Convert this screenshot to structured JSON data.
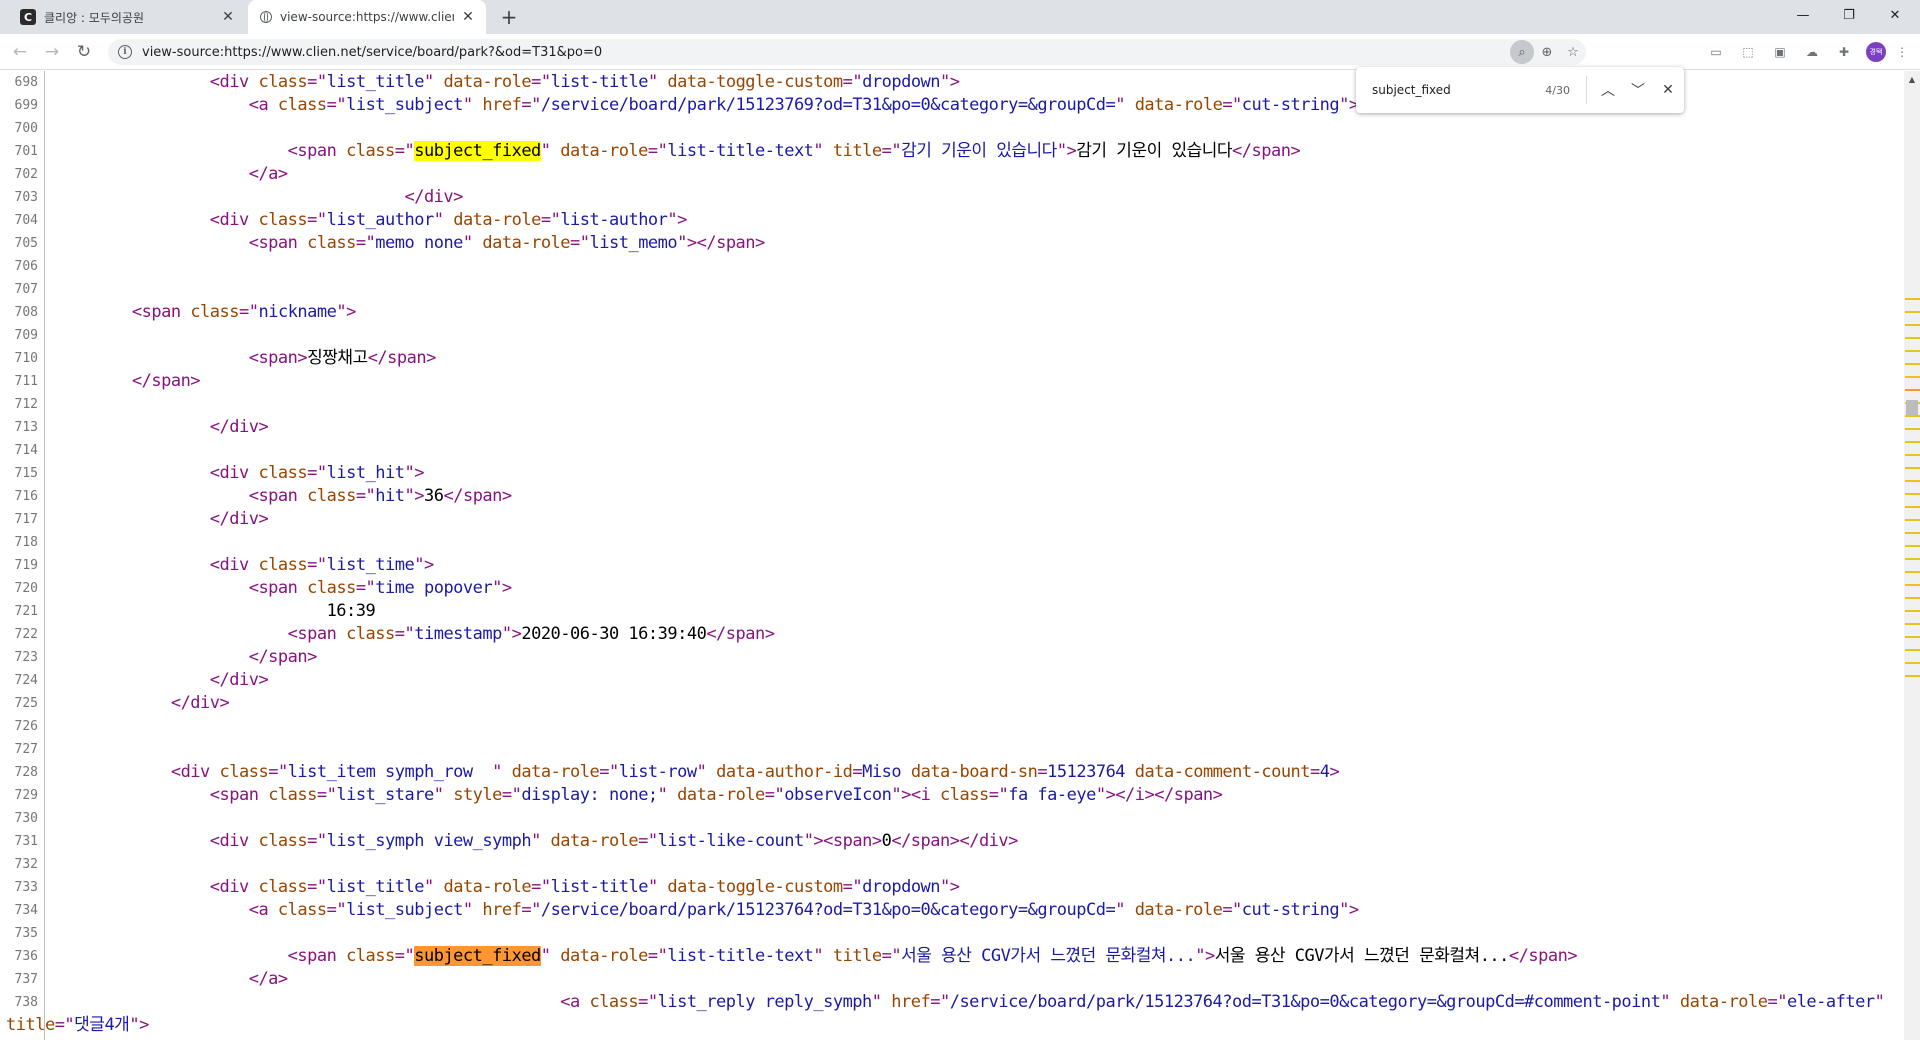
{
  "tabs": [
    {
      "title": "클리앙 : 모두의공원",
      "favicon": "C"
    },
    {
      "title": "view-source:https://www.clien.ne"
    }
  ],
  "new_tab_symbol": "+",
  "window_controls": {
    "minimize": "—",
    "maximize": "❐",
    "close": "✕"
  },
  "url": "view-source:https://www.clien.net/service/board/park?&od=T31&po=0",
  "avatar_text": "경택",
  "find": {
    "query": "subject_fixed",
    "count": "4/30"
  },
  "lines": [
    {
      "n": "698",
      "s": [
        {
          "c": "x",
          "t": "                "
        },
        {
          "c": "t",
          "t": "<div "
        },
        {
          "c": "a",
          "t": "class"
        },
        {
          "c": "t",
          "t": "=\""
        },
        {
          "c": "v",
          "t": "list_title"
        },
        {
          "c": "t",
          "t": "\" "
        },
        {
          "c": "a",
          "t": "data-role"
        },
        {
          "c": "t",
          "t": "=\""
        },
        {
          "c": "v",
          "t": "list-title"
        },
        {
          "c": "t",
          "t": "\" "
        },
        {
          "c": "a",
          "t": "data-toggle-custom"
        },
        {
          "c": "t",
          "t": "=\""
        },
        {
          "c": "v",
          "t": "dropdown"
        },
        {
          "c": "t",
          "t": "\">"
        }
      ]
    },
    {
      "n": "699",
      "s": [
        {
          "c": "x",
          "t": "                    "
        },
        {
          "c": "t",
          "t": "<a "
        },
        {
          "c": "a",
          "t": "class"
        },
        {
          "c": "t",
          "t": "=\""
        },
        {
          "c": "v",
          "t": "list_subject"
        },
        {
          "c": "t",
          "t": "\" "
        },
        {
          "c": "a",
          "t": "href"
        },
        {
          "c": "t",
          "t": "=\""
        },
        {
          "c": "v",
          "t": "/service/board/park/15123769?od=T31&po=0&category=&groupCd="
        },
        {
          "c": "t",
          "t": "\" "
        },
        {
          "c": "a",
          "t": "data-role"
        },
        {
          "c": "t",
          "t": "=\""
        },
        {
          "c": "v",
          "t": "cut-string"
        },
        {
          "c": "t",
          "t": "\">"
        }
      ]
    },
    {
      "n": "700",
      "s": []
    },
    {
      "n": "701",
      "s": [
        {
          "c": "x",
          "t": "                        "
        },
        {
          "c": "t",
          "t": "<span "
        },
        {
          "c": "a",
          "t": "class"
        },
        {
          "c": "t",
          "t": "=\""
        },
        {
          "c": "hl",
          "t": "subject_fixed"
        },
        {
          "c": "t",
          "t": "\" "
        },
        {
          "c": "a",
          "t": "data-role"
        },
        {
          "c": "t",
          "t": "=\""
        },
        {
          "c": "v",
          "t": "list-title-text"
        },
        {
          "c": "t",
          "t": "\" "
        },
        {
          "c": "a",
          "t": "title"
        },
        {
          "c": "t",
          "t": "=\""
        },
        {
          "c": "v",
          "t": "감기 기운이 있습니다"
        },
        {
          "c": "t",
          "t": "\">"
        },
        {
          "c": "x",
          "t": "감기 기운이 있습니다"
        },
        {
          "c": "t",
          "t": "</span>"
        }
      ]
    },
    {
      "n": "702",
      "s": [
        {
          "c": "x",
          "t": "                    "
        },
        {
          "c": "t",
          "t": "</a>"
        }
      ]
    },
    {
      "n": "703",
      "s": [
        {
          "c": "x",
          "t": "                                    "
        },
        {
          "c": "t",
          "t": "</div>"
        }
      ]
    },
    {
      "n": "704",
      "s": [
        {
          "c": "x",
          "t": "                "
        },
        {
          "c": "t",
          "t": "<div "
        },
        {
          "c": "a",
          "t": "class"
        },
        {
          "c": "t",
          "t": "=\""
        },
        {
          "c": "v",
          "t": "list_author"
        },
        {
          "c": "t",
          "t": "\" "
        },
        {
          "c": "a",
          "t": "data-role"
        },
        {
          "c": "t",
          "t": "=\""
        },
        {
          "c": "v",
          "t": "list-author"
        },
        {
          "c": "t",
          "t": "\">"
        }
      ]
    },
    {
      "n": "705",
      "s": [
        {
          "c": "x",
          "t": "                    "
        },
        {
          "c": "t",
          "t": "<span "
        },
        {
          "c": "a",
          "t": "class"
        },
        {
          "c": "t",
          "t": "=\""
        },
        {
          "c": "v",
          "t": "memo none"
        },
        {
          "c": "t",
          "t": "\" "
        },
        {
          "c": "a",
          "t": "data-role"
        },
        {
          "c": "t",
          "t": "=\""
        },
        {
          "c": "v",
          "t": "list_memo"
        },
        {
          "c": "t",
          "t": "\"></span>"
        }
      ]
    },
    {
      "n": "706",
      "s": []
    },
    {
      "n": "707",
      "s": []
    },
    {
      "n": "708",
      "s": [
        {
          "c": "x",
          "t": "        "
        },
        {
          "c": "t",
          "t": "<span "
        },
        {
          "c": "a",
          "t": "class"
        },
        {
          "c": "t",
          "t": "=\""
        },
        {
          "c": "v",
          "t": "nickname"
        },
        {
          "c": "t",
          "t": "\">"
        }
      ]
    },
    {
      "n": "709",
      "s": []
    },
    {
      "n": "710",
      "s": [
        {
          "c": "x",
          "t": "                    "
        },
        {
          "c": "t",
          "t": "<span>"
        },
        {
          "c": "x",
          "t": "징짱채고"
        },
        {
          "c": "t",
          "t": "</span>"
        }
      ]
    },
    {
      "n": "711",
      "s": [
        {
          "c": "x",
          "t": "        "
        },
        {
          "c": "t",
          "t": "</span>"
        }
      ]
    },
    {
      "n": "712",
      "s": []
    },
    {
      "n": "713",
      "s": [
        {
          "c": "x",
          "t": "                "
        },
        {
          "c": "t",
          "t": "</div>"
        }
      ]
    },
    {
      "n": "714",
      "s": []
    },
    {
      "n": "715",
      "s": [
        {
          "c": "x",
          "t": "                "
        },
        {
          "c": "t",
          "t": "<div "
        },
        {
          "c": "a",
          "t": "class"
        },
        {
          "c": "t",
          "t": "=\""
        },
        {
          "c": "v",
          "t": "list_hit"
        },
        {
          "c": "t",
          "t": "\">"
        }
      ]
    },
    {
      "n": "716",
      "s": [
        {
          "c": "x",
          "t": "                    "
        },
        {
          "c": "t",
          "t": "<span "
        },
        {
          "c": "a",
          "t": "class"
        },
        {
          "c": "t",
          "t": "=\""
        },
        {
          "c": "v",
          "t": "hit"
        },
        {
          "c": "t",
          "t": "\">"
        },
        {
          "c": "x",
          "t": "36"
        },
        {
          "c": "t",
          "t": "</span>"
        }
      ]
    },
    {
      "n": "717",
      "s": [
        {
          "c": "x",
          "t": "                "
        },
        {
          "c": "t",
          "t": "</div>"
        }
      ]
    },
    {
      "n": "718",
      "s": []
    },
    {
      "n": "719",
      "s": [
        {
          "c": "x",
          "t": "                "
        },
        {
          "c": "t",
          "t": "<div "
        },
        {
          "c": "a",
          "t": "class"
        },
        {
          "c": "t",
          "t": "=\""
        },
        {
          "c": "v",
          "t": "list_time"
        },
        {
          "c": "t",
          "t": "\">"
        }
      ]
    },
    {
      "n": "720",
      "s": [
        {
          "c": "x",
          "t": "                    "
        },
        {
          "c": "t",
          "t": "<span "
        },
        {
          "c": "a",
          "t": "class"
        },
        {
          "c": "t",
          "t": "=\""
        },
        {
          "c": "v",
          "t": "time popover"
        },
        {
          "c": "t",
          "t": "\">"
        }
      ]
    },
    {
      "n": "721",
      "s": [
        {
          "c": "x",
          "t": "                            16:39"
        }
      ]
    },
    {
      "n": "722",
      "s": [
        {
          "c": "x",
          "t": "                        "
        },
        {
          "c": "t",
          "t": "<span "
        },
        {
          "c": "a",
          "t": "class"
        },
        {
          "c": "t",
          "t": "=\""
        },
        {
          "c": "v",
          "t": "timestamp"
        },
        {
          "c": "t",
          "t": "\">"
        },
        {
          "c": "x",
          "t": "2020-06-30 16:39:40"
        },
        {
          "c": "t",
          "t": "</span>"
        }
      ]
    },
    {
      "n": "723",
      "s": [
        {
          "c": "x",
          "t": "                    "
        },
        {
          "c": "t",
          "t": "</span>"
        }
      ]
    },
    {
      "n": "724",
      "s": [
        {
          "c": "x",
          "t": "                "
        },
        {
          "c": "t",
          "t": "</div>"
        }
      ]
    },
    {
      "n": "725",
      "s": [
        {
          "c": "x",
          "t": "            "
        },
        {
          "c": "t",
          "t": "</div>"
        }
      ]
    },
    {
      "n": "726",
      "s": []
    },
    {
      "n": "727",
      "s": []
    },
    {
      "n": "728",
      "s": [
        {
          "c": "x",
          "t": "            "
        },
        {
          "c": "t",
          "t": "<div "
        },
        {
          "c": "a",
          "t": "class"
        },
        {
          "c": "t",
          "t": "=\""
        },
        {
          "c": "v",
          "t": "list_item symph_row  "
        },
        {
          "c": "t",
          "t": "\" "
        },
        {
          "c": "a",
          "t": "data-role"
        },
        {
          "c": "t",
          "t": "=\""
        },
        {
          "c": "v",
          "t": "list-row"
        },
        {
          "c": "t",
          "t": "\" "
        },
        {
          "c": "a",
          "t": "data-author-id"
        },
        {
          "c": "t",
          "t": "="
        },
        {
          "c": "v",
          "t": "Miso"
        },
        {
          "c": "t",
          "t": " "
        },
        {
          "c": "a",
          "t": "data-board-sn"
        },
        {
          "c": "t",
          "t": "="
        },
        {
          "c": "v",
          "t": "15123764"
        },
        {
          "c": "t",
          "t": " "
        },
        {
          "c": "a",
          "t": "data-comment-count"
        },
        {
          "c": "t",
          "t": "="
        },
        {
          "c": "v",
          "t": "4"
        },
        {
          "c": "t",
          "t": ">"
        }
      ]
    },
    {
      "n": "729",
      "s": [
        {
          "c": "x",
          "t": "                "
        },
        {
          "c": "t",
          "t": "<span "
        },
        {
          "c": "a",
          "t": "class"
        },
        {
          "c": "t",
          "t": "=\""
        },
        {
          "c": "v",
          "t": "list_stare"
        },
        {
          "c": "t",
          "t": "\" "
        },
        {
          "c": "a",
          "t": "style"
        },
        {
          "c": "t",
          "t": "=\""
        },
        {
          "c": "v",
          "t": "display: none;"
        },
        {
          "c": "t",
          "t": "\" "
        },
        {
          "c": "a",
          "t": "data-role"
        },
        {
          "c": "t",
          "t": "=\""
        },
        {
          "c": "v",
          "t": "observeIcon"
        },
        {
          "c": "t",
          "t": "\"><i "
        },
        {
          "c": "a",
          "t": "class"
        },
        {
          "c": "t",
          "t": "=\""
        },
        {
          "c": "v",
          "t": "fa fa-eye"
        },
        {
          "c": "t",
          "t": "\"></i></span>"
        }
      ]
    },
    {
      "n": "730",
      "s": []
    },
    {
      "n": "731",
      "s": [
        {
          "c": "x",
          "t": "                "
        },
        {
          "c": "t",
          "t": "<div "
        },
        {
          "c": "a",
          "t": "class"
        },
        {
          "c": "t",
          "t": "=\""
        },
        {
          "c": "v",
          "t": "list_symph view_symph"
        },
        {
          "c": "t",
          "t": "\" "
        },
        {
          "c": "a",
          "t": "data-role"
        },
        {
          "c": "t",
          "t": "=\""
        },
        {
          "c": "v",
          "t": "list-like-count"
        },
        {
          "c": "t",
          "t": "\"><span>"
        },
        {
          "c": "x",
          "t": "0"
        },
        {
          "c": "t",
          "t": "</span></div>"
        }
      ]
    },
    {
      "n": "732",
      "s": []
    },
    {
      "n": "733",
      "s": [
        {
          "c": "x",
          "t": "                "
        },
        {
          "c": "t",
          "t": "<div "
        },
        {
          "c": "a",
          "t": "class"
        },
        {
          "c": "t",
          "t": "=\""
        },
        {
          "c": "v",
          "t": "list_title"
        },
        {
          "c": "t",
          "t": "\" "
        },
        {
          "c": "a",
          "t": "data-role"
        },
        {
          "c": "t",
          "t": "=\""
        },
        {
          "c": "v",
          "t": "list-title"
        },
        {
          "c": "t",
          "t": "\" "
        },
        {
          "c": "a",
          "t": "data-toggle-custom"
        },
        {
          "c": "t",
          "t": "=\""
        },
        {
          "c": "v",
          "t": "dropdown"
        },
        {
          "c": "t",
          "t": "\">"
        }
      ]
    },
    {
      "n": "734",
      "s": [
        {
          "c": "x",
          "t": "                    "
        },
        {
          "c": "t",
          "t": "<a "
        },
        {
          "c": "a",
          "t": "class"
        },
        {
          "c": "t",
          "t": "=\""
        },
        {
          "c": "v",
          "t": "list_subject"
        },
        {
          "c": "t",
          "t": "\" "
        },
        {
          "c": "a",
          "t": "href"
        },
        {
          "c": "t",
          "t": "=\""
        },
        {
          "c": "v",
          "t": "/service/board/park/15123764?od=T31&po=0&category=&groupCd="
        },
        {
          "c": "t",
          "t": "\" "
        },
        {
          "c": "a",
          "t": "data-role"
        },
        {
          "c": "t",
          "t": "=\""
        },
        {
          "c": "v",
          "t": "cut-string"
        },
        {
          "c": "t",
          "t": "\">"
        }
      ]
    },
    {
      "n": "735",
      "s": []
    },
    {
      "n": "736",
      "s": [
        {
          "c": "x",
          "t": "                        "
        },
        {
          "c": "t",
          "t": "<span "
        },
        {
          "c": "a",
          "t": "class"
        },
        {
          "c": "t",
          "t": "=\""
        },
        {
          "c": "hl-cur",
          "t": "subject_fixed"
        },
        {
          "c": "t",
          "t": "\" "
        },
        {
          "c": "a",
          "t": "data-role"
        },
        {
          "c": "t",
          "t": "=\""
        },
        {
          "c": "v",
          "t": "list-title-text"
        },
        {
          "c": "t",
          "t": "\" "
        },
        {
          "c": "a",
          "t": "title"
        },
        {
          "c": "t",
          "t": "=\""
        },
        {
          "c": "v",
          "t": "서울 용산 CGV가서 느꼈던 문화컬쳐..."
        },
        {
          "c": "t",
          "t": "\">"
        },
        {
          "c": "x",
          "t": "서울 용산 CGV가서 느꼈던 문화컬쳐..."
        },
        {
          "c": "t",
          "t": "</span>"
        }
      ]
    },
    {
      "n": "737",
      "s": [
        {
          "c": "x",
          "t": "                    "
        },
        {
          "c": "t",
          "t": "</a>"
        }
      ]
    },
    {
      "n": "738",
      "s": [
        {
          "c": "x",
          "t": "                                                    "
        },
        {
          "c": "t",
          "t": "<a "
        },
        {
          "c": "a",
          "t": "class"
        },
        {
          "c": "t",
          "t": "=\""
        },
        {
          "c": "v",
          "t": "list_reply reply_symph"
        },
        {
          "c": "t",
          "t": "\" "
        },
        {
          "c": "a",
          "t": "href"
        },
        {
          "c": "t",
          "t": "=\""
        },
        {
          "c": "v",
          "t": "/service/board/park/15123764?od=T31&po=0&category=&groupCd=#comment-point"
        },
        {
          "c": "t",
          "t": "\" "
        },
        {
          "c": "a",
          "t": "data-role"
        },
        {
          "c": "t",
          "t": "=\""
        },
        {
          "c": "v",
          "t": "ele-after"
        },
        {
          "c": "t",
          "t": "\""
        }
      ]
    },
    {
      "n": "",
      "s": [
        {
          "c": "a",
          "t": "title"
        },
        {
          "c": "t",
          "t": "=\""
        },
        {
          "c": "v",
          "t": "댓글4개"
        },
        {
          "c": "t",
          "t": "\">"
        }
      ]
    }
  ]
}
